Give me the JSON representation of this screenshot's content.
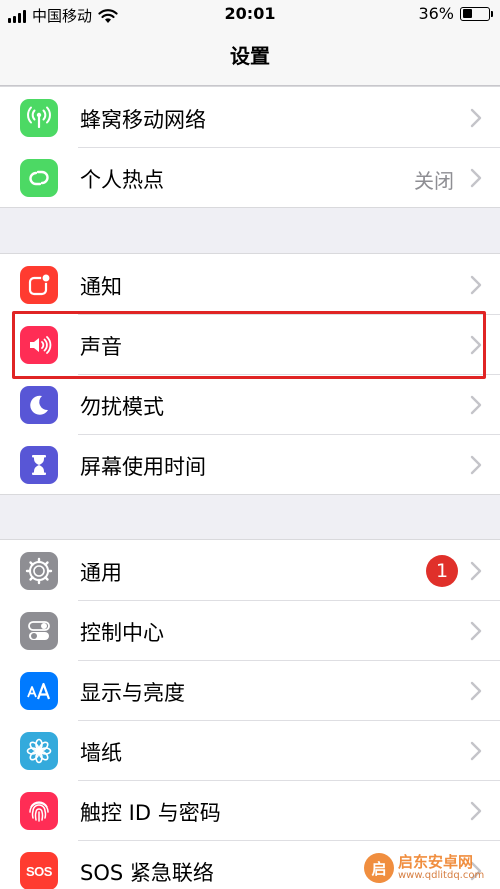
{
  "status_bar": {
    "carrier": "中国移动",
    "time": "20:01",
    "battery_percent": "36%",
    "battery_level": 0.36
  },
  "nav": {
    "title": "设置"
  },
  "groups": [
    {
      "items": [
        {
          "label": "蜂窝移动网络",
          "icon": "cellular-antenna-icon",
          "color": "#4cd964"
        },
        {
          "label": "个人热点",
          "value": "关闭",
          "icon": "hotspot-link-icon",
          "color": "#4cd964"
        }
      ]
    },
    {
      "items": [
        {
          "label": "通知",
          "icon": "notifications-icon",
          "color": "#ff3b30"
        },
        {
          "label": "声音",
          "icon": "speaker-icon",
          "color": "#ff2d55"
        },
        {
          "label": "勿扰模式",
          "icon": "moon-icon",
          "color": "#5856d6"
        },
        {
          "label": "屏幕使用时间",
          "icon": "hourglass-icon",
          "color": "#5856d6"
        }
      ]
    },
    {
      "items": [
        {
          "label": "通用",
          "badge": "1",
          "icon": "gear-icon",
          "color": "#8e8e93"
        },
        {
          "label": "控制中心",
          "icon": "toggles-icon",
          "color": "#8e8e93"
        },
        {
          "label": "显示与亮度",
          "icon": "text-size-icon",
          "color": "#007aff"
        },
        {
          "label": "墙纸",
          "icon": "flower-icon",
          "color": "#34aadc"
        },
        {
          "label": "触控 ID 与密码",
          "icon": "fingerprint-icon",
          "color": "#ff2d55"
        },
        {
          "label": "SOS 紧急联络",
          "icon": "sos-icon",
          "color": "#ff3b30"
        }
      ]
    }
  ],
  "watermark": {
    "logo_char": "启",
    "name": "启东安卓网",
    "url": "www.qdlitdq.com"
  }
}
